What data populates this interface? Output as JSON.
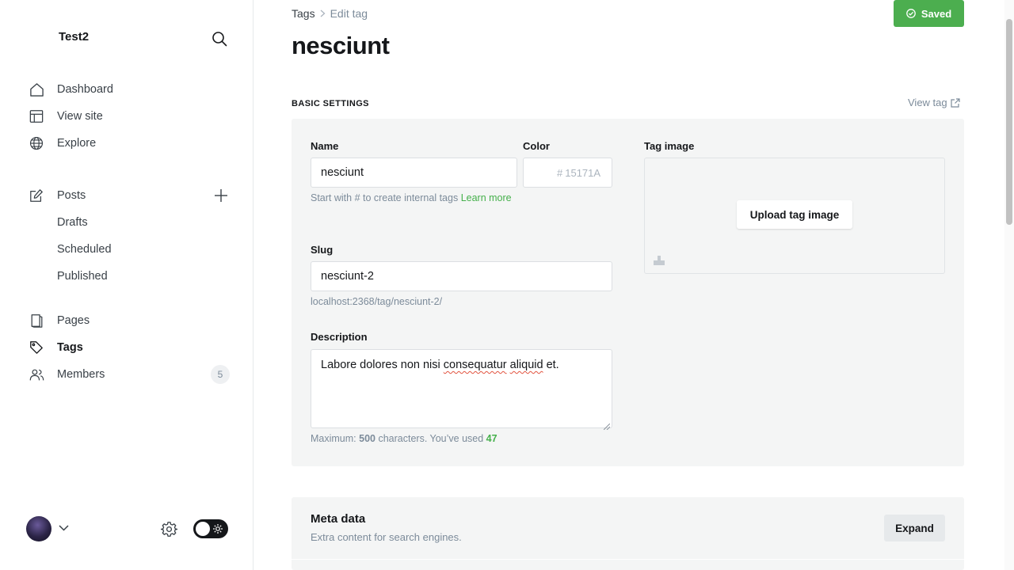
{
  "sidebar": {
    "site_title": "Test2",
    "nav": {
      "dashboard": "Dashboard",
      "view_site": "View site",
      "explore": "Explore",
      "posts": "Posts",
      "drafts": "Drafts",
      "scheduled": "Scheduled",
      "published": "Published",
      "pages": "Pages",
      "tags": "Tags",
      "members": "Members"
    },
    "members_count": "5"
  },
  "header": {
    "breadcrumb_parent": "Tags",
    "breadcrumb_current": "Edit tag",
    "title": "nesciunt",
    "saved_label": "Saved"
  },
  "basic_settings": {
    "section_title": "BASIC SETTINGS",
    "view_tag_label": "View tag",
    "name_label": "Name",
    "name_value": "nesciunt",
    "name_hint": "Start with # to create internal tags",
    "name_hint_link": "Learn more",
    "color_label": "Color",
    "color_hash": "#",
    "color_placeholder": "15171A",
    "tag_image_label": "Tag image",
    "upload_label": "Upload tag image",
    "slug_label": "Slug",
    "slug_value": "nesciunt-2",
    "slug_url": "localhost:2368/tag/nesciunt-2/",
    "description_label": "Description",
    "description_value_parts": [
      "Labore dolores non nisi ",
      "consequatur",
      " ",
      "aliquid",
      " et."
    ],
    "desc_hint_prefix": "Maximum: ",
    "desc_hint_max": "500",
    "desc_hint_mid": " characters. You’ve used ",
    "desc_hint_used": "47"
  },
  "meta": {
    "title": "Meta data",
    "subtitle": "Extra content for search engines.",
    "expand_label": "Expand"
  },
  "colors": {
    "accent_green": "#4cae4f",
    "text": "#15171a",
    "muted": "#7c8b9a",
    "panel": "#f4f5f5"
  }
}
